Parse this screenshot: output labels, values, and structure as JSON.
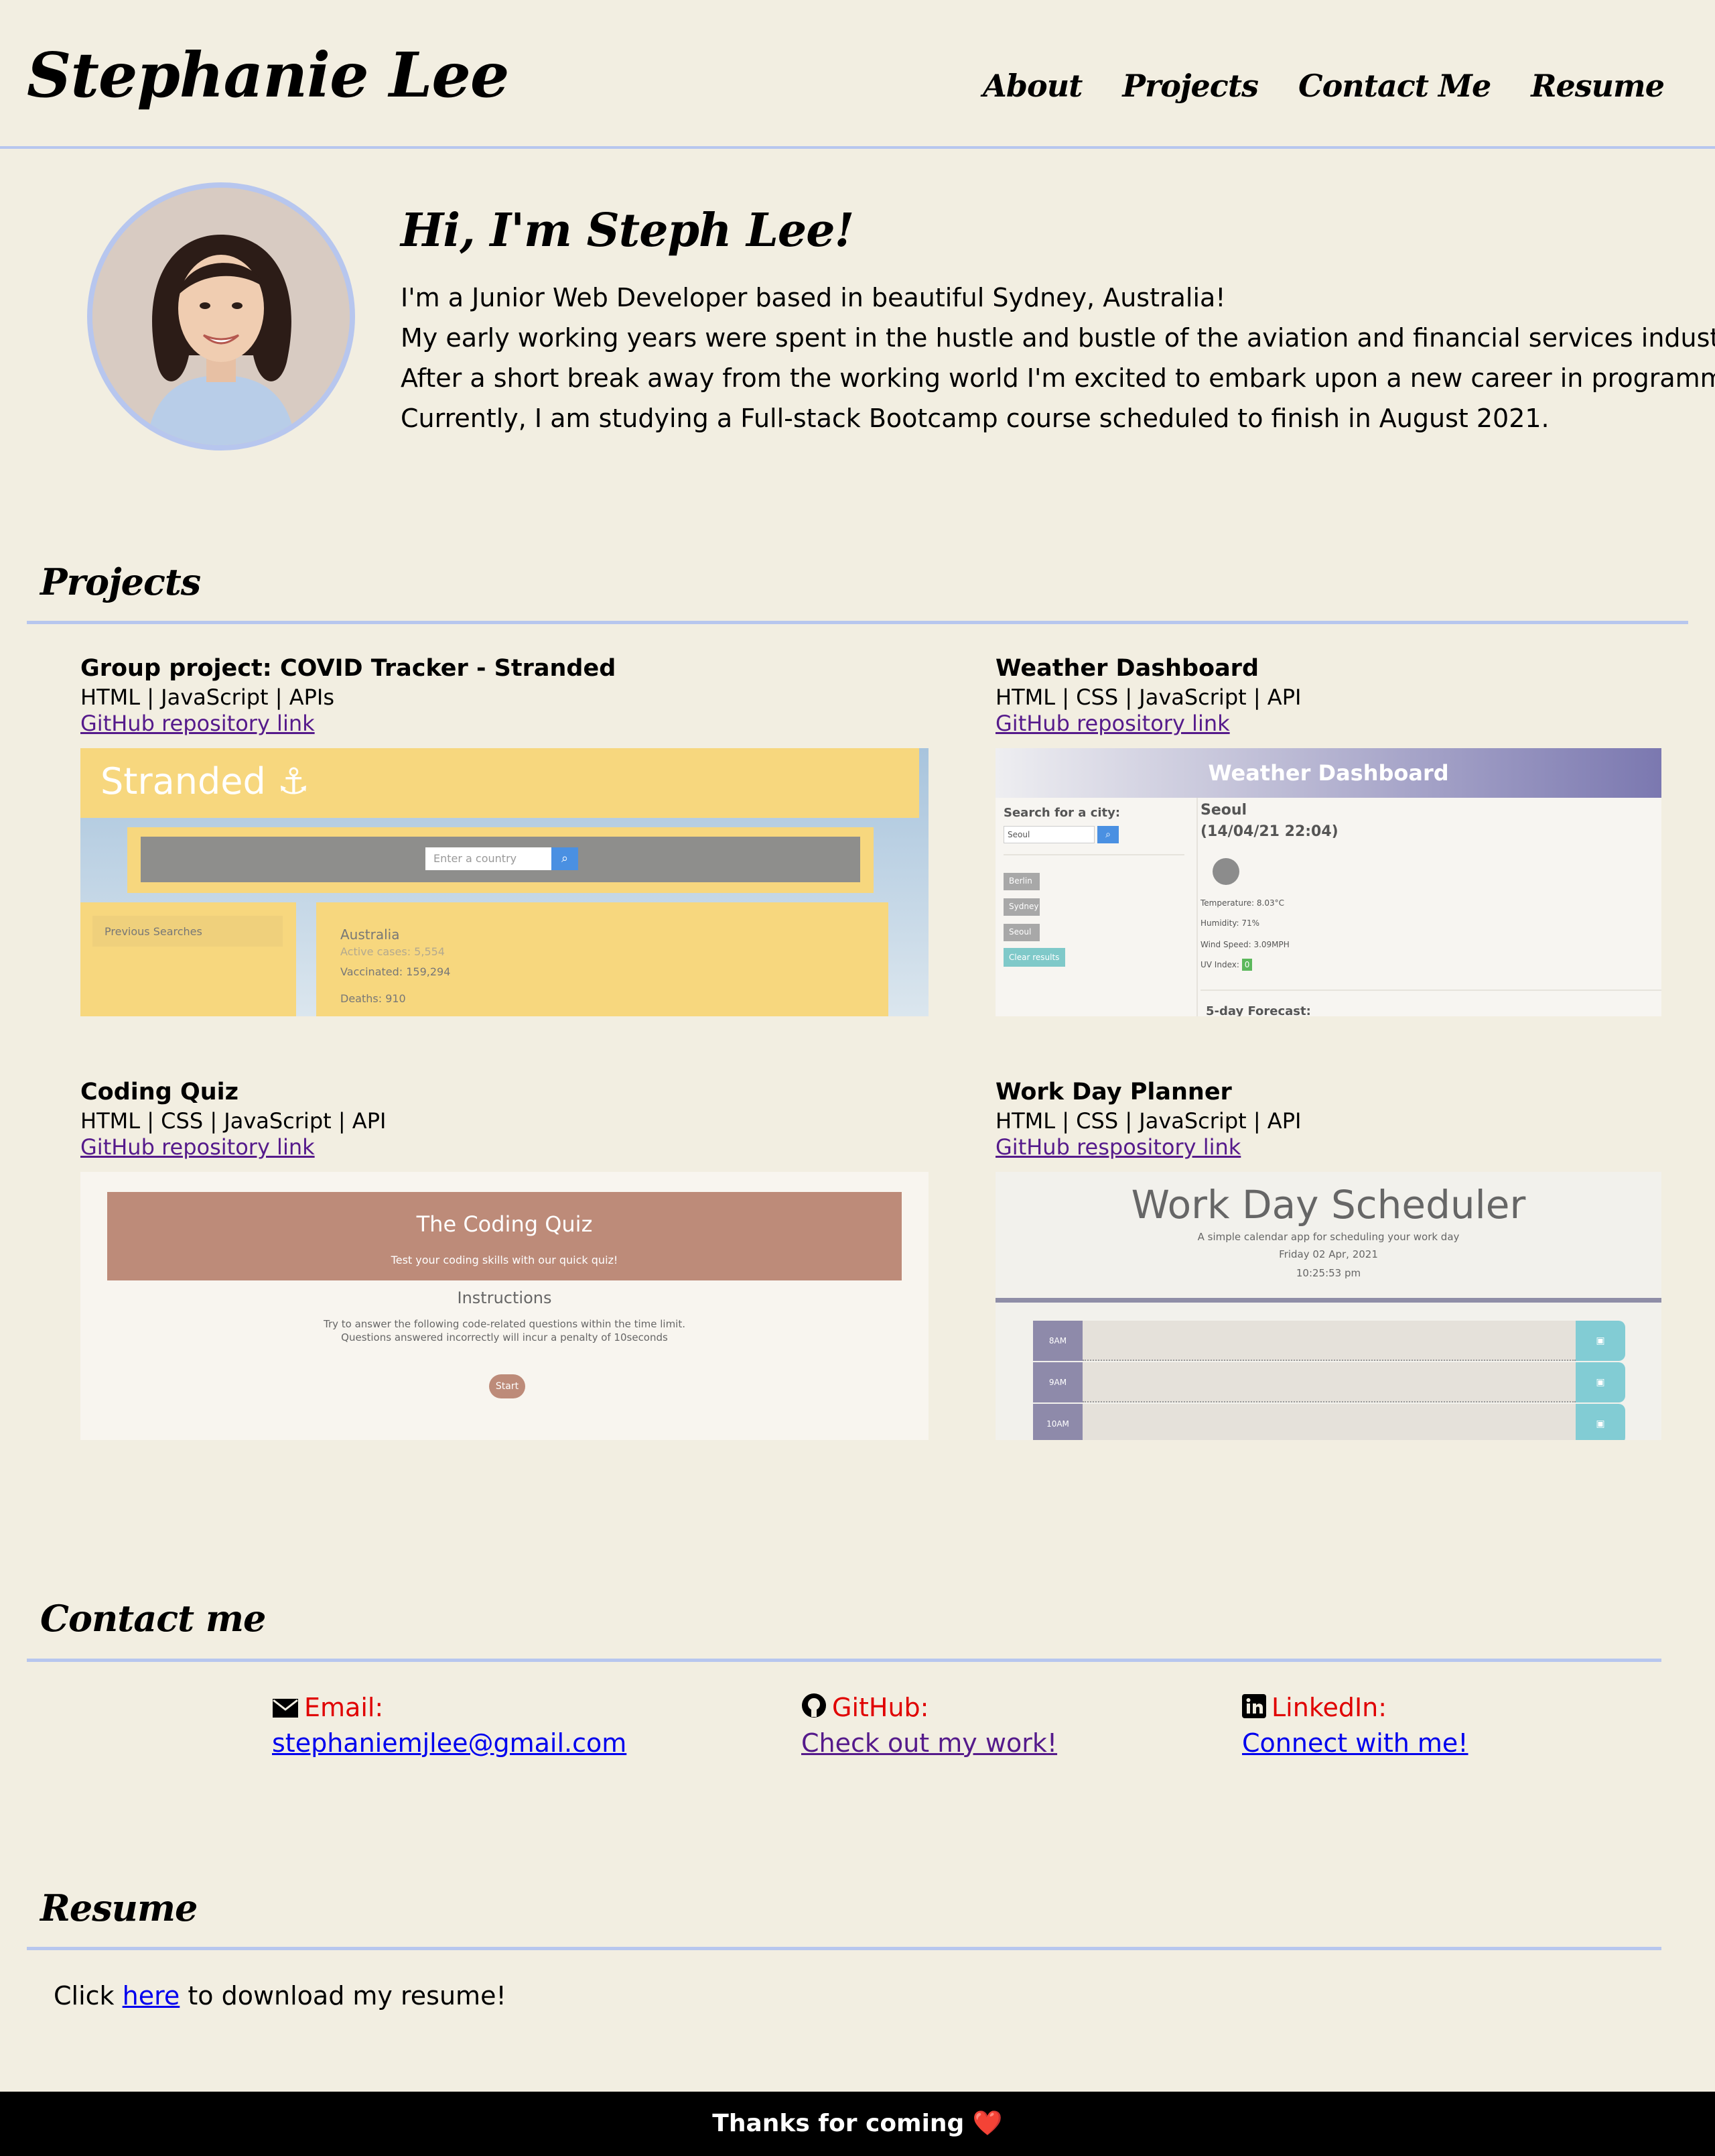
{
  "header": {
    "site_title": "Stephanie Lee",
    "nav": [
      "About",
      "Projects",
      "Contact Me",
      "Resume"
    ]
  },
  "hero": {
    "heading": "Hi, I'm Steph Lee!",
    "paragraphs": [
      "I'm a Junior Web Developer based in beautiful Sydney, Australia!",
      "My early working years were spent in the hustle and bustle of the aviation and financial services industries.",
      "After a short break away from the working world I'm excited to embark upon a new career in programming.",
      "Currently, I am studying a Full-stack Bootcamp course scheduled to finish in August 2021."
    ]
  },
  "projects": {
    "title": "Projects",
    "items": [
      {
        "title": "Group project: COVID Tracker - Stranded",
        "tech": "HTML | JavaScript | APIs",
        "link": "GitHub repository link",
        "shot": {
          "brand": "Stranded",
          "placeholder": "Enter a country",
          "previous": "Previous Searches",
          "country": "Australia",
          "active": "Active cases: 5,554",
          "vaccinated": "Vaccinated: 159,294",
          "deaths": "Deaths: 910"
        }
      },
      {
        "title": "Weather Dashboard",
        "tech": "HTML | CSS | JavaScript | API",
        "link": "GitHub repository link",
        "shot": {
          "header": "Weather Dashboard",
          "search_label": "Search for a city:",
          "search_value": "Seoul",
          "cities": [
            "Berlin",
            "Sydney",
            "Seoul"
          ],
          "clear": "Clear results",
          "city": "Seoul",
          "datetime": "(14/04/21 22:04)",
          "temperature": "Temperature: 8.03°C",
          "humidity": "Humidity: 71%",
          "wind": "Wind Speed: 3.09MPH",
          "uv_label": "UV Index:",
          "uv_value": "0",
          "forecast": "5-day Forecast:"
        }
      },
      {
        "title": "Coding Quiz",
        "tech": "HTML | CSS | JavaScript | API",
        "link": "GitHub repository link",
        "shot": {
          "header": "The Coding Quiz",
          "subtitle": "Test your coding skills with our quick quiz!",
          "instructions_title": "Instructions",
          "instructions_1": "Try to answer the following code-related questions within the time limit.",
          "instructions_2": "Questions answered incorrectly will incur a penalty of 10seconds",
          "start": "Start"
        }
      },
      {
        "title": "Work Day Planner",
        "tech": "HTML | CSS | JavaScript | API",
        "link": "GitHub respository link",
        "shot": {
          "header": "Work Day Scheduler",
          "subtitle": "A simple calendar app for scheduling your work day",
          "date": "Friday 02 Apr, 2021",
          "time": "10:25:53 pm",
          "hours": [
            "8AM",
            "9AM",
            "10AM"
          ]
        }
      }
    ]
  },
  "contact": {
    "title": "Contact me",
    "email": {
      "label": "Email:",
      "value": "stephaniemjlee@gmail.com",
      "icon": "envelope-icon"
    },
    "github": {
      "label": "GitHub:",
      "value": "Check out my work!",
      "icon": "github-icon"
    },
    "linkedin": {
      "label": "LinkedIn:",
      "value": "Connect with me!",
      "icon": "linkedin-icon"
    }
  },
  "resume": {
    "title": "Resume",
    "before": "Click ",
    "link": "here",
    "after": " to download my resume!"
  },
  "footer": {
    "text": "Thanks for coming",
    "emoji": "❤️"
  },
  "colors": {
    "background": "#f2eee1",
    "accent_line": "#b7c6ee",
    "contact_label": "#e00000",
    "visited_link": "#551a8b",
    "link": "#0000ee"
  }
}
